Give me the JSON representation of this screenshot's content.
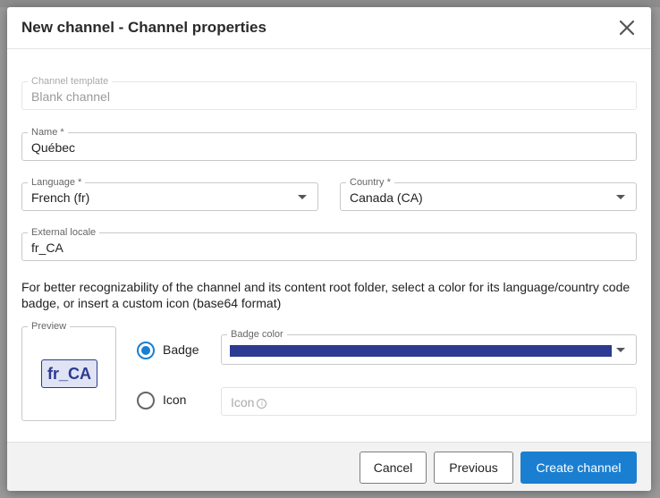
{
  "dialog": {
    "title": "New channel - Channel properties"
  },
  "form": {
    "channel_template": {
      "label": "Channel template",
      "value": "Blank channel"
    },
    "name": {
      "label": "Name *",
      "value": "Québec"
    },
    "language": {
      "label": "Language *",
      "value": "French (fr)"
    },
    "country": {
      "label": "Country *",
      "value": "Canada (CA)"
    },
    "external_locale": {
      "label": "External locale",
      "value": "fr_CA"
    },
    "help_text": "For better recognizability of the channel and its content root folder, select a color for its language/country code badge, or insert a custom icon (base64 format)",
    "preview": {
      "label": "Preview",
      "badge_text": "fr_CA"
    },
    "badge_option": {
      "label": "Badge",
      "selected": true
    },
    "icon_option": {
      "label": "Icon",
      "selected": false
    },
    "badge_color": {
      "label": "Badge color",
      "value": "#2c3a91"
    },
    "icon_input": {
      "placeholder": "Icon"
    }
  },
  "footer": {
    "cancel_label": "Cancel",
    "previous_label": "Previous",
    "create_label": "Create channel"
  },
  "colors": {
    "accent": "#1a7fd1",
    "badge": "#2c3a91"
  }
}
